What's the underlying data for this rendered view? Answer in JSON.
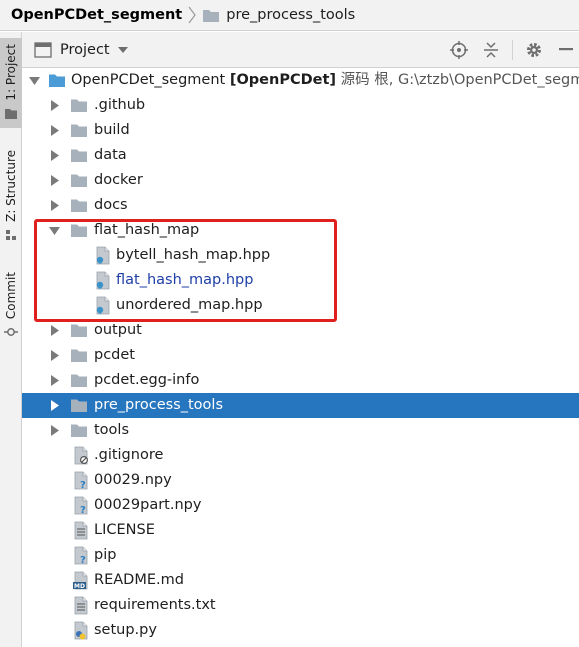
{
  "breadcrumb": {
    "root": "OpenPCDet_segment",
    "child": "pre_process_tools"
  },
  "side_strip": {
    "tabs": [
      {
        "label": "1: Project",
        "icon": "folder-icon",
        "active": true
      },
      {
        "label": "Z: Structure",
        "icon": "structure-icon",
        "active": false
      },
      {
        "label": "Commit",
        "icon": "commit-icon",
        "active": false
      }
    ]
  },
  "panel": {
    "title": "Project",
    "tools": [
      "locate-icon",
      "collapse-icon",
      "gear-icon",
      "minimize-icon"
    ]
  },
  "tree": {
    "root": {
      "name": "OpenPCDet_segment",
      "bracket": "[OpenPCDet]",
      "meta": "源码 根,  G:\\ztzb\\OpenPCDet_segm"
    },
    "folders_top": [
      ".github",
      "build",
      "data",
      "docker",
      "docs"
    ],
    "open_folder": {
      "name": "flat_hash_map",
      "files": [
        {
          "name": "bytell_hash_map.hpp",
          "color": "#1e1e1e"
        },
        {
          "name": "flat_hash_map.hpp",
          "color": "#1f3fa8"
        },
        {
          "name": "unordered_map.hpp",
          "color": "#1e1e1e"
        }
      ]
    },
    "folders_bottom": [
      "output",
      "pcdet",
      "pcdet.egg-info",
      "pre_process_tools",
      "tools"
    ],
    "selected_folder": "pre_process_tools",
    "files": [
      {
        "name": ".gitignore",
        "icon": "ignore-file-icon"
      },
      {
        "name": "00029.npy",
        "icon": "unknown-file-icon"
      },
      {
        "name": "00029part.npy",
        "icon": "unknown-file-icon"
      },
      {
        "name": "LICENSE",
        "icon": "text-file-icon"
      },
      {
        "name": "pip",
        "icon": "unknown-file-icon"
      },
      {
        "name": "README.md",
        "icon": "markdown-file-icon"
      },
      {
        "name": "requirements.txt",
        "icon": "text-file-icon"
      },
      {
        "name": "setup.py",
        "icon": "python-file-icon"
      }
    ]
  },
  "colors": {
    "selection": "#2675bf",
    "highlight_box": "#e0201c",
    "folder": "#a7b1bb",
    "root_folder": "#4a9bd6"
  }
}
